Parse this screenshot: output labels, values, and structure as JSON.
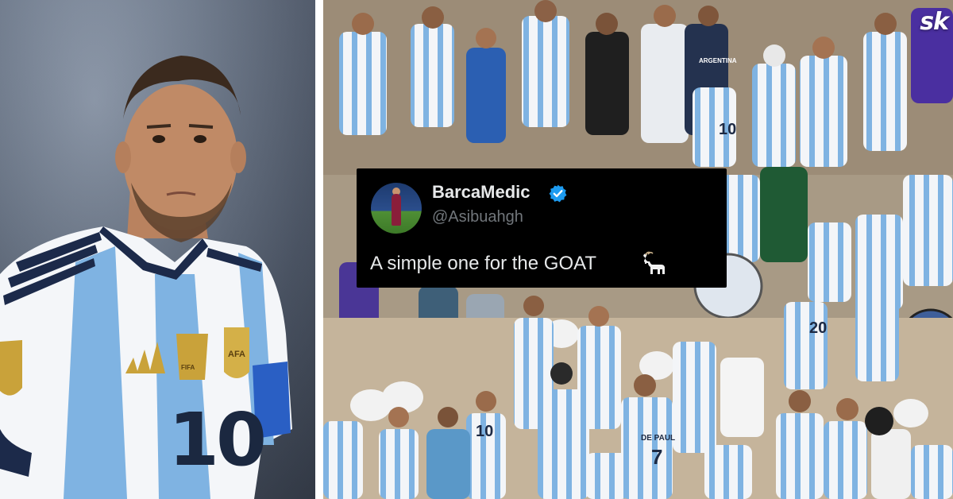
{
  "brand": {
    "logo_text": "sk"
  },
  "left_photo": {
    "alt": "Player in Argentina shirt",
    "shirt_number": "10",
    "crest_text": "AFA",
    "badge_text": "FIFA"
  },
  "tweet": {
    "display_name": "BarcaMedic",
    "handle": "@Asibuahgh",
    "text": "A simple one for the GOAT",
    "emoji_icon": "goat-icon",
    "verified_icon": "verified-badge-icon"
  },
  "right_photo": {
    "jersey_text_1": "ARGENTINA",
    "jersey_number_1": "10",
    "jersey_name_2": "DE PAUL",
    "jersey_number_2": "7",
    "jersey_number_3": "10",
    "jersey_number_4": "20"
  },
  "colors": {
    "argentina_sky_blue": "#75aadb",
    "tweet_bg": "#000000",
    "verified_blue": "#1d9bf0",
    "handle_gray": "#71767b"
  }
}
